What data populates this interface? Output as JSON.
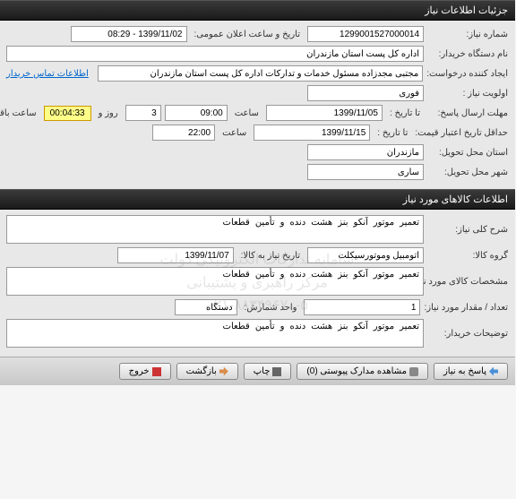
{
  "sections": {
    "need_info_header": "جزئیات اطلاعات نیاز",
    "goods_info_header": "اطلاعات کالاهای مورد نیاز"
  },
  "need": {
    "number_label": "شماره نیاز:",
    "number_value": "1299001527000014",
    "announce_label": "تاریخ و ساعت اعلان عمومی:",
    "announce_value": "1399/11/02 - 08:29",
    "buyer_org_label": "نام دستگاه خریدار:",
    "buyer_org_value": "اداره کل پست استان مازندران",
    "requester_label": "ایجاد کننده درخواست:",
    "requester_value": "مجتبی مجدزاده مسئول خدمات و تدارکات اداره کل پست استان مازندران",
    "contact_link": "اطلاعات تماس خریدار",
    "priority_label": "اولویت نیاز :",
    "priority_value": "فوری",
    "deadline_label": "مهلت ارسال پاسخ:",
    "to_date_label": "تا تاریخ :",
    "deadline_date": "1399/11/05",
    "time_label": "ساعت",
    "deadline_time": "09:00",
    "days_value": "3",
    "days_suffix": "روز و",
    "countdown": "00:04:33",
    "remaining_suffix": "ساعت باقی مانده",
    "min_validity_label": "حداقل تاریخ اعتبار قیمت:",
    "validity_date": "1399/11/15",
    "validity_time": "22:00",
    "province_label": "استان محل تحویل:",
    "province_value": "مازندران",
    "city_label": "شهر محل تحویل:",
    "city_value": "ساری"
  },
  "goods": {
    "general_desc_label": "شرح کلی نیاز:",
    "general_desc_value": "تعمیر موتور آنکو بنز هشت دنده و تأمین قطعات",
    "group_label": "گروه کالا:",
    "group_value": "اتومبیل وموتورسیکلت",
    "iran_code_date_label": "تاریخ نیاز به کالا:",
    "iran_code_date_value": "1399/11/07",
    "specs_label": "مشخصات کالای مورد نیاز:",
    "specs_value": "تعمیر موتور آنکو بنز هشت دنده و تأمین قطعات",
    "qty_label": "تعداد / مقدار مورد نیاز:",
    "qty_value": "1",
    "unit_label": "واحد شمارش:",
    "unit_value": "دستگاه",
    "buyer_notes_label": "توضیحات خریدار:",
    "buyer_notes_value": "تعمیر موتور آنکو بنز هشت دنده و تأمین قطعات"
  },
  "watermark": {
    "line1": "سامانه تدارکات الکترونیکی دولت",
    "line2": "مرکز راهبری و پشتیبانی",
    "line3": "۰۲۱-۸۸۳۴۹۶۷۰-۵"
  },
  "buttons": {
    "reply": "پاسخ به نیاز",
    "attachments": "مشاهده مدارک پیوستی (0)",
    "print": "چاپ",
    "back": "بازگشت",
    "exit": "خروج"
  }
}
